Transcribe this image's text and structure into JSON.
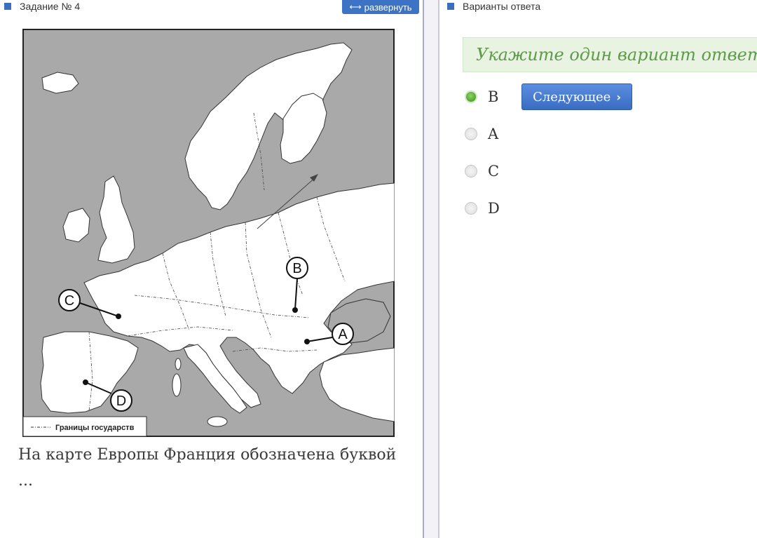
{
  "task_panel": {
    "title": "Задание № 4",
    "expand_label": "развернуть",
    "map": {
      "legend_text": "Границы государств",
      "markers": [
        "A",
        "B",
        "C",
        "D"
      ]
    },
    "question": "На карте Европы Франция обозначена буквой ..."
  },
  "answer_panel": {
    "title": "Варианты ответа",
    "hint": "Укажите один вариант ответа",
    "next_label": "Следующее",
    "options": [
      {
        "label": "B",
        "selected": true
      },
      {
        "label": "A",
        "selected": false
      },
      {
        "label": "C",
        "selected": false
      },
      {
        "label": "D",
        "selected": false
      }
    ]
  },
  "colors": {
    "accent": "#3d73c4",
    "sea": "#a9a9a9",
    "hint_bg": "#e8f3e2",
    "hint_text": "#5d9b4a",
    "radio_selected": "#4fa52b"
  }
}
